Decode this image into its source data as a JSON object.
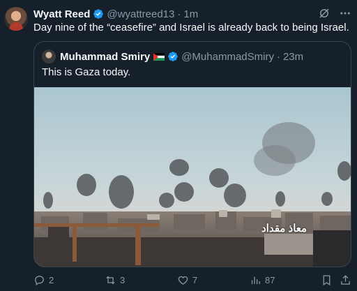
{
  "tweet": {
    "author_name": "Wyatt Reed",
    "author_handle": "@wyattreed13",
    "separator": "·",
    "time": "1m",
    "text": "Day nine of the “ceasefire” and Israel is already back to being Israel."
  },
  "quoted_tweet": {
    "author_name": "Muhammad Smiry",
    "author_handle": "@MuhammadSmiry",
    "separator": "·",
    "time": "23m",
    "text": "This is Gaza today.",
    "media_watermark": "معاذ مقداد"
  },
  "actions": {
    "replies": "2",
    "reposts": "3",
    "likes": "7",
    "views": "87"
  },
  "colors": {
    "background": "#15202b",
    "primary_text": "#f7f9f9",
    "secondary_text": "#8b98a5",
    "verified_blue": "#1d9bf0",
    "border": "#38444d"
  },
  "icons": [
    "verified-badge-icon",
    "grok-icon",
    "more-icon",
    "palestine-flag-icon",
    "reply-icon",
    "repost-icon",
    "like-icon",
    "views-icon",
    "bookmark-icon",
    "share-icon"
  ]
}
